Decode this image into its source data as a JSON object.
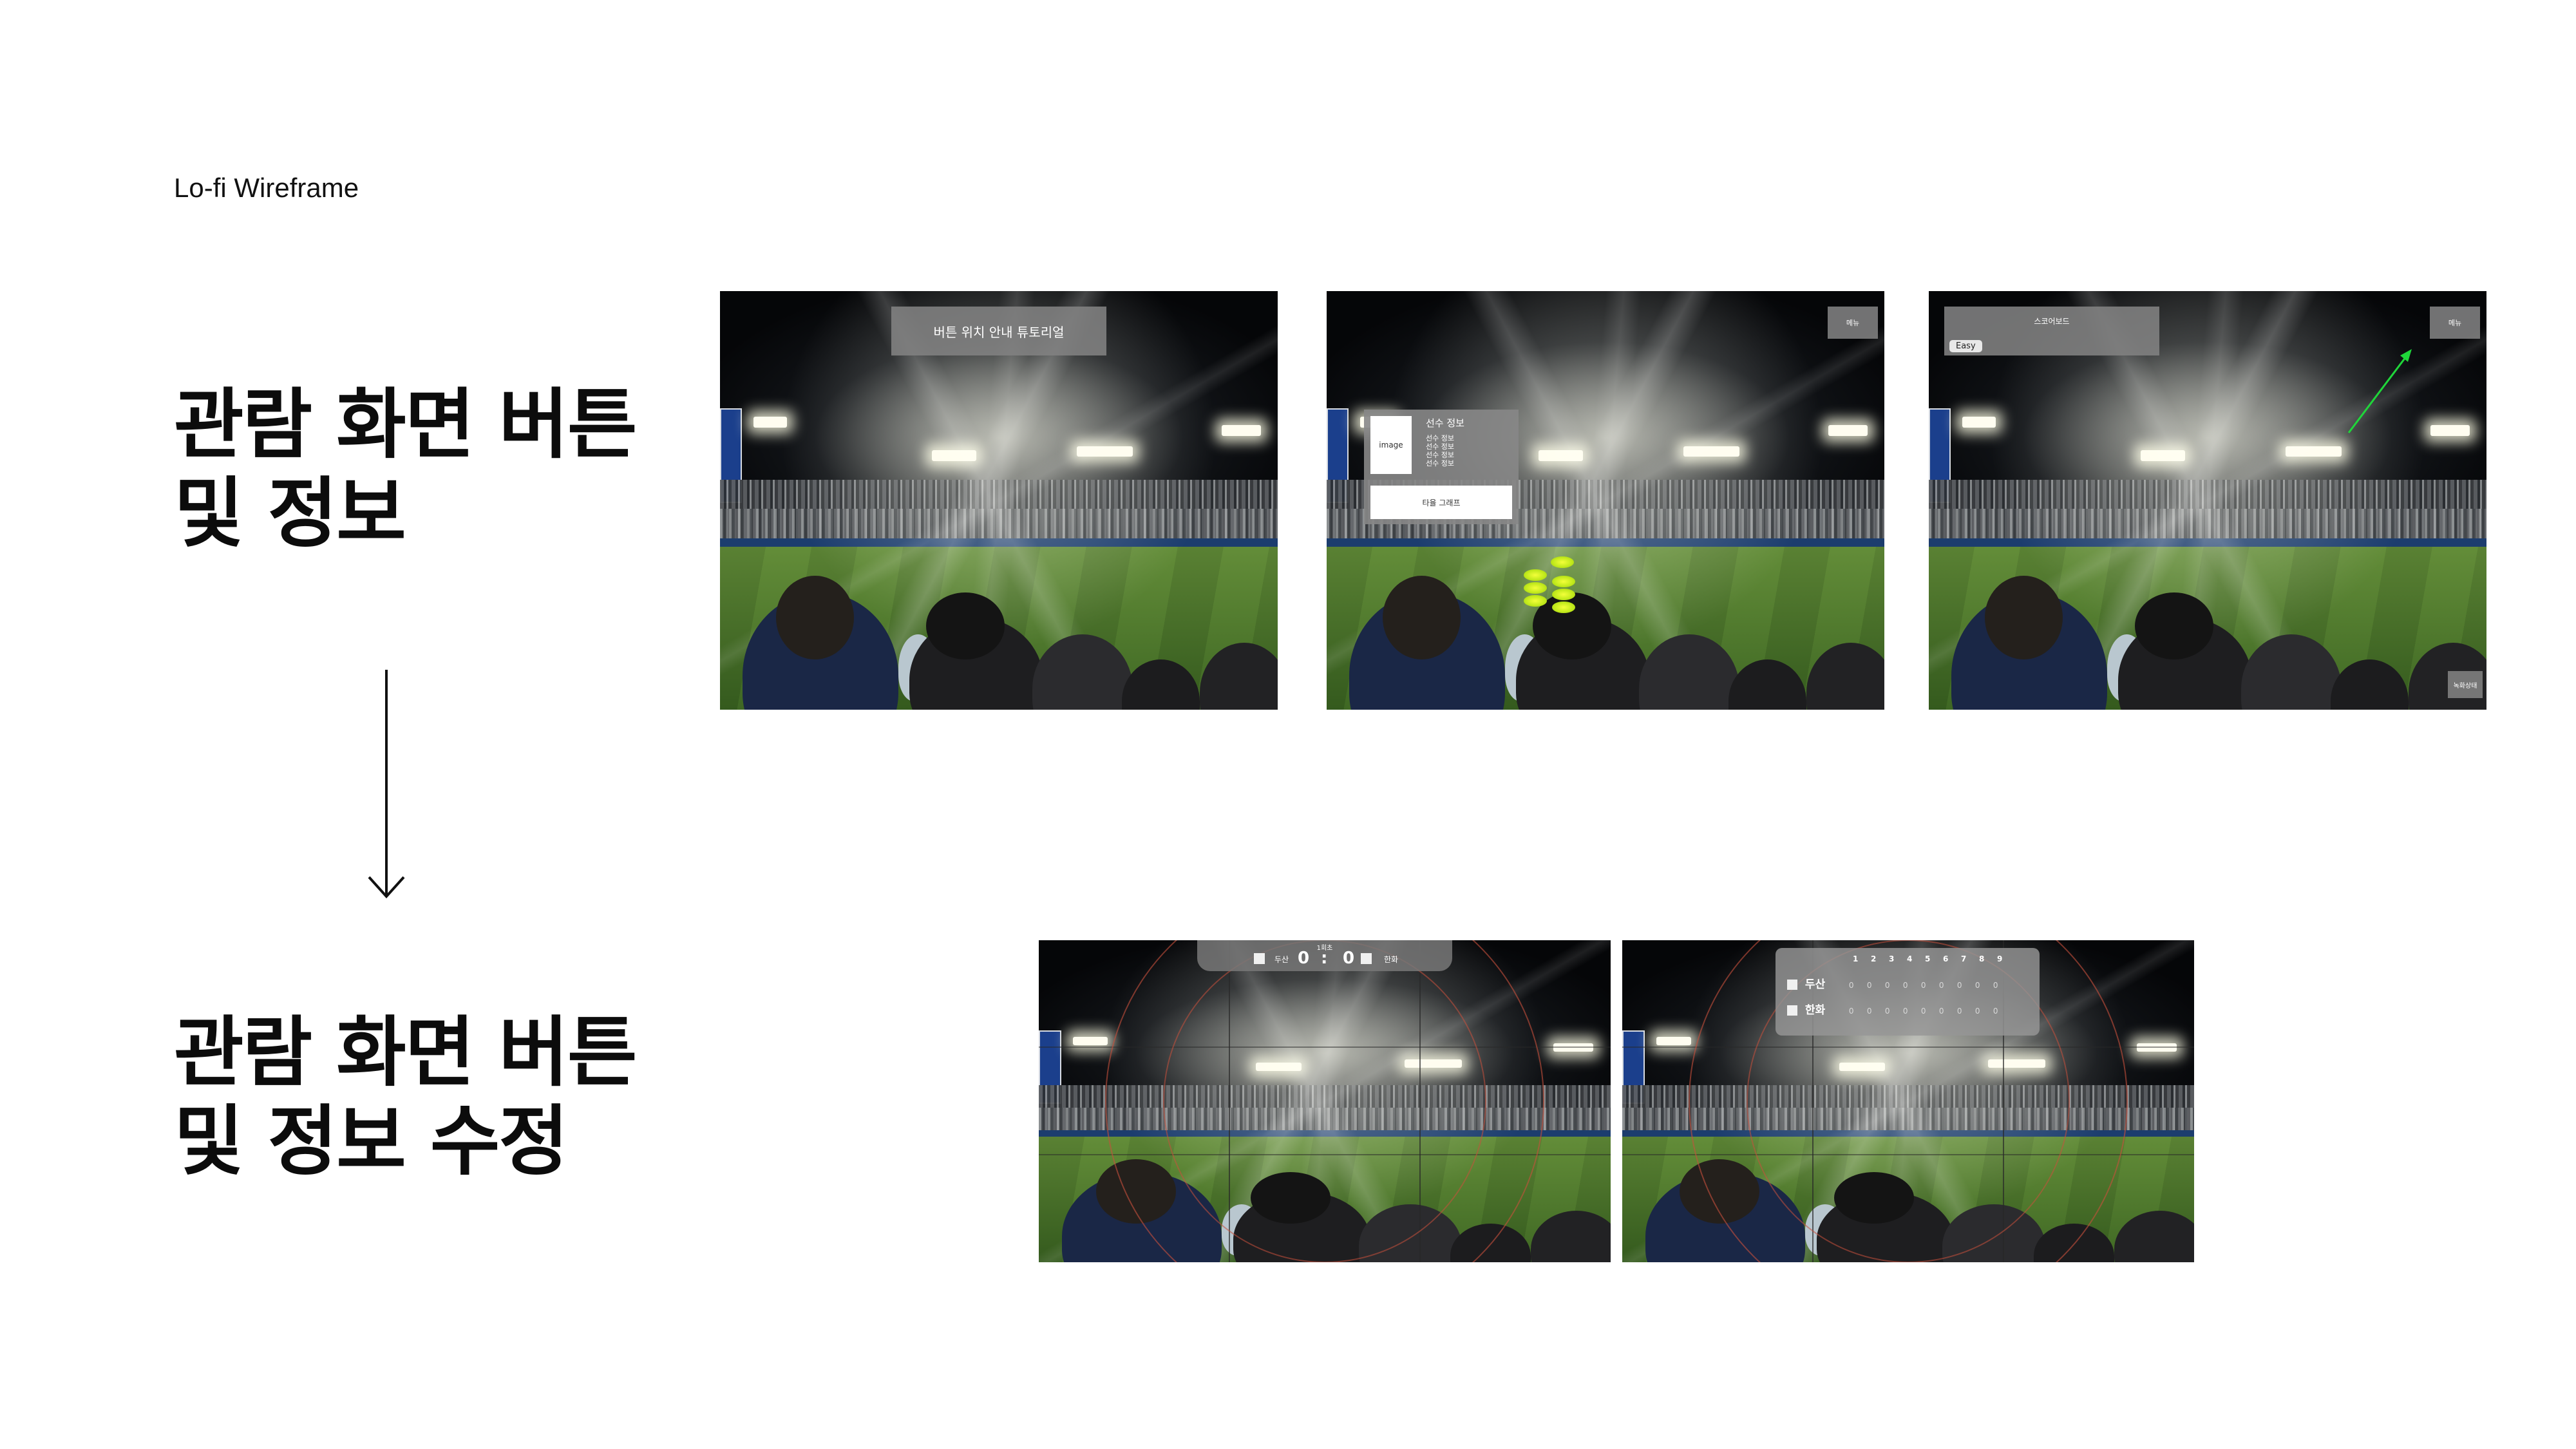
{
  "slide": {
    "section_label": "Lo-fi Wireframe",
    "heading_top": [
      "관람 화면 버튼",
      "및 정보"
    ],
    "heading_bottom": [
      "관람 화면 버튼",
      "및 정보 수정"
    ]
  },
  "screens": {
    "tutorial": {
      "banner": "버튼 위치 안내 튜토리얼"
    },
    "player_info": {
      "top_button": "메뉴",
      "image_label": "image",
      "title": "선수 정보",
      "rows": [
        "선수 정보",
        "선수 정보",
        "선수 정보",
        "선수 정보"
      ],
      "chart_button": "타율 그래프"
    },
    "scoreboard_mode": {
      "banner": "스코어보드",
      "mode_badge": "Easy",
      "top_button": "메뉴",
      "bottom_button": "녹화상태",
      "pointer_color": "#1fd63a"
    },
    "score_overlay": {
      "inning": "1회초",
      "home_team": "두산",
      "home_score": "0",
      "separator": ":",
      "away_score": "0",
      "away_team": "한화"
    },
    "inning_overlay": {
      "innings": [
        "1",
        "2",
        "3",
        "4",
        "5",
        "6",
        "7",
        "8",
        "9"
      ],
      "teams": [
        {
          "name": "두산",
          "scores": [
            "0",
            "0",
            "0",
            "0",
            "0",
            "0",
            "0",
            "0",
            "0"
          ]
        },
        {
          "name": "한화",
          "scores": [
            "0",
            "0",
            "0",
            "0",
            "0",
            "0",
            "0",
            "0",
            "0"
          ]
        }
      ]
    }
  }
}
